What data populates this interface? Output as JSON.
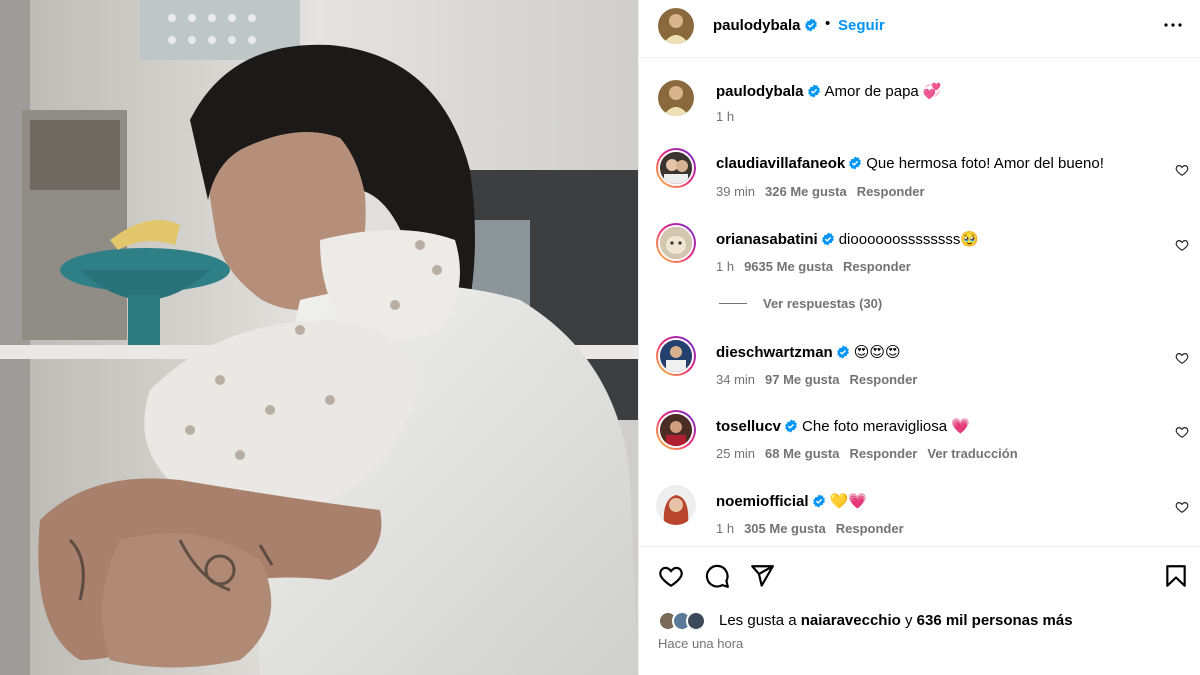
{
  "post": {
    "username": "paulodybala",
    "separator": "•",
    "follow_label": "Seguir",
    "caption": "Amor de papa 💞",
    "caption_time": "1 h"
  },
  "comments": [
    {
      "username": "claudiavillafaneok",
      "text": "Que hermosa foto! Amor del bueno!",
      "time": "39 min",
      "likes": "326 Me gusta",
      "reply": "Responder",
      "translate": ""
    },
    {
      "username": "orianasabatini",
      "text": "dioooooossssssss🥹",
      "time": "1 h",
      "likes": "9635 Me gusta",
      "reply": "Responder",
      "translate": ""
    },
    {
      "username": "dieschwartzman",
      "text": "😍😍😍",
      "time": "34 min",
      "likes": "97 Me gusta",
      "reply": "Responder",
      "translate": ""
    },
    {
      "username": "tosellucv",
      "text": "Che foto meravigliosa 💗",
      "time": "25 min",
      "likes": "68 Me gusta",
      "reply": "Responder",
      "translate": "Ver traducción"
    },
    {
      "username": "noemiofficial",
      "text": "💛💗",
      "time": "1 h",
      "likes": "305 Me gusta",
      "reply": "Responder",
      "translate": ""
    }
  ],
  "view_replies": "Ver respuestas (30)",
  "footer": {
    "likes_prefix": "Les gusta a",
    "liker": "naiaravecchio",
    "likes_and": "y",
    "likes_rest": "636 mil personas más",
    "posted_time": "Hace una hora"
  },
  "icons": {
    "verified": "verified-badge-icon",
    "more": "more-options-icon",
    "like": "heart-icon",
    "comment": "comment-icon",
    "share": "share-icon",
    "save": "bookmark-icon"
  },
  "colors": {
    "accent": "#0095f6",
    "verified": "#0095f6",
    "muted": "#737373"
  }
}
